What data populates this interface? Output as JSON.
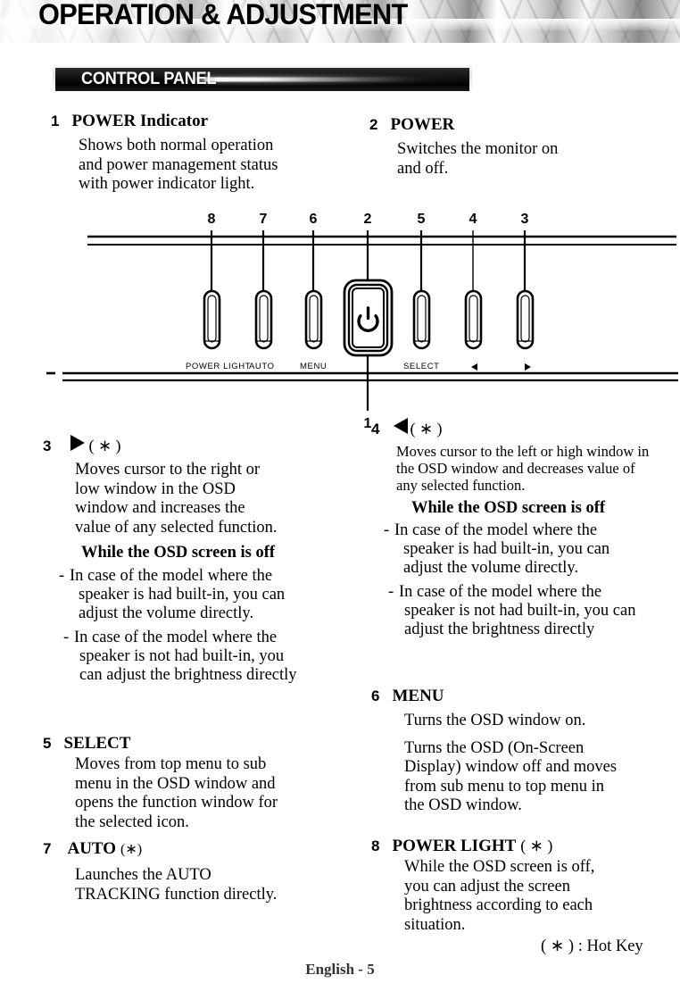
{
  "header": {
    "title": "OPERATION & ADJUSTMENT",
    "section_title": "CONTROL PANEL"
  },
  "items": {
    "item1": {
      "number": "1",
      "label": "POWER Indicator",
      "lines": [
        "Shows both normal operation",
        "and power management status",
        "with power indicator light."
      ]
    },
    "item2": {
      "number": "2",
      "label": "POWER",
      "lines": [
        "Switches the monitor on",
        "and off."
      ]
    },
    "item3": {
      "number": "3",
      "icon": "right-arrow-icon",
      "hotkey": "( ∗ )",
      "lines": [
        "Moves cursor to the right  or",
        "low window in the OSD",
        "window and  increases the",
        "value of any selected function."
      ],
      "bold_line": "While the OSD screen is off",
      "bullets": [
        [
          "In case of the model where the",
          "speaker is had built-in, you can",
          "adjust the volume directly."
        ],
        [
          "In case of the model where the",
          "speaker is not had built-in, you",
          "can adjust the brightness directly"
        ]
      ]
    },
    "item4": {
      "number": "4",
      "icon": "left-arrow-icon",
      "hotkey": "( ∗ )",
      "lines": [
        "Moves cursor to the left or high window in",
        "the OSD window and  decreases value of",
        "any selected  function."
      ],
      "bold_line": "While the OSD screen is off",
      "bullets": [
        [
          "In case  of the model where the",
          "speaker is had built-in, you can",
          "adjust the volume directly."
        ],
        [
          "In case of the model where the",
          "speaker is not had built-in, you can",
          "adjust the brightness directly"
        ]
      ]
    },
    "item5": {
      "number": "5",
      "label": "SELECT",
      "lines": [
        "Moves from top menu to sub",
        "menu in the OSD window and",
        "opens the function window for",
        "the selected icon."
      ]
    },
    "item6": {
      "number": "6",
      "label": "MENU",
      "lines_a": [
        "Turns the OSD window on."
      ],
      "lines_b": [
        "Turns the OSD (On-Screen",
        "Display) window off and moves",
        "from sub menu to top menu in",
        "the OSD window."
      ]
    },
    "item7": {
      "number": "7",
      "label": "AUTO",
      "hotkey": "(∗)",
      "lines": [
        "Launches the AUTO",
        "TRACKING function directly."
      ]
    },
    "item8": {
      "number": "8",
      "label": "POWER LIGHT",
      "hotkey": "( ∗ )",
      "lines": [
        "While the OSD screen is off,",
        "you can adjust the screen",
        "brightness according to each",
        "situation."
      ]
    }
  },
  "diagram": {
    "callout_numbers": [
      "8",
      "7",
      "6",
      "2",
      "5",
      "4",
      "3"
    ],
    "bottom_callout_number": "1",
    "button_labels": [
      "POWER LIGHT",
      "AUTO",
      "MENU",
      "SELECT"
    ],
    "arrow_left_label": "◀",
    "arrow_right_label": "▶",
    "power_icon": "power-symbol-icon"
  },
  "footnote": "( ∗ ) : Hot Key",
  "footer": "English - 5",
  "colors": {
    "ink": "#000000",
    "banner_dark": "#000000",
    "footer_gray": "#333333"
  }
}
